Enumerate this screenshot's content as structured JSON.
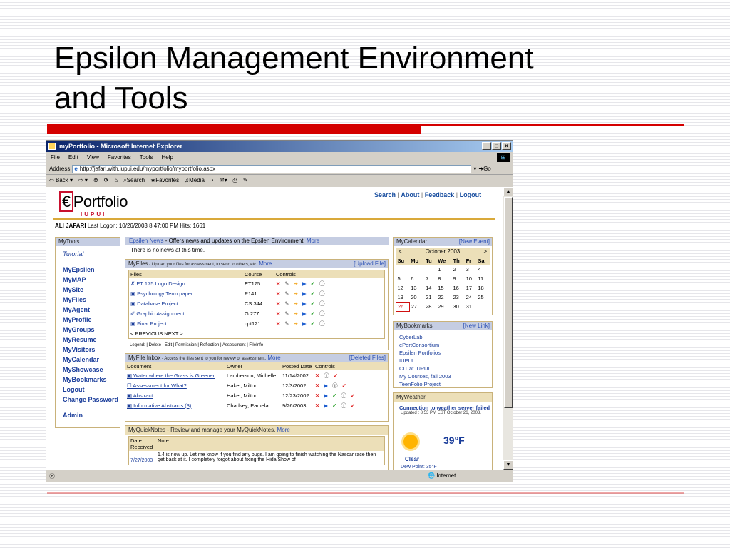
{
  "slide": {
    "title_line1": "Epsilon Management Environment",
    "title_line2": "and Tools"
  },
  "browser": {
    "title": "myPortfolio - Microsoft Internet Explorer",
    "menu": [
      "File",
      "Edit",
      "View",
      "Favorites",
      "Tools",
      "Help"
    ],
    "address_label": "Address",
    "url": "http://jafari.with.iupui.edu/myportfolio/myportfolio.aspx",
    "go_label": "Go",
    "toolbar": [
      "Back",
      "Search",
      "Favorites",
      "Media"
    ],
    "status_zone": "Internet"
  },
  "page": {
    "logo_text": "Portfolio",
    "logo_sub": "IUPUI",
    "nav": [
      "Search",
      "About",
      "Feedback",
      "Logout"
    ],
    "user": "ALI JAFARI",
    "last_logon": "Last Logon: 10/26/2003 8:47:00 PM Hits: 1661"
  },
  "mytools": {
    "title": "MyTools",
    "tutorial": "Tutorial",
    "items": [
      "MyEpsilen",
      "MyMAP",
      "MySite",
      "MyFiles",
      "MyAgent",
      "MyProfile",
      "MyGroups",
      "MyResume",
      "MyVisitors",
      "MyCalendar",
      "MyShowcase",
      "MyBookmarks",
      "Logout",
      "Change Password"
    ],
    "admin": "Admin"
  },
  "news": {
    "title": "Epsilen News",
    "desc": " - Offers news and updates on the Epsilen Environment.",
    "more": "More",
    "body": "There is no news at this time."
  },
  "myfiles": {
    "title": "MyFiles",
    "desc": " - Upload your files for assessment, to send to others, etc.",
    "more": "More",
    "upload": "[Upload File]",
    "columns": [
      "Files",
      "Course",
      "Controls"
    ],
    "rows": [
      {
        "file": "ET 175 Logo Design",
        "course": "ET175"
      },
      {
        "file": "Psychology Term paper",
        "course": "P141"
      },
      {
        "file": "Database Project",
        "course": "CS 344"
      },
      {
        "file": "Graphic Assignment",
        "course": "G 277"
      },
      {
        "file": "Final Project",
        "course": "cpt121"
      }
    ],
    "pager": "< PREVIOUS NEXT >",
    "legend": "Legend: | Delete | Edit | Permission | Reflection | Assessment | FileInfo"
  },
  "inbox": {
    "title": "MyFile Inbox",
    "desc": " - Access the files sent to you for review or assessment.",
    "more": "More",
    "deleted": "[Deleted Files]",
    "columns": [
      "Document",
      "Owner",
      "Posted Date",
      "Controls"
    ],
    "rows": [
      {
        "doc": "Water where the Grass is Greener",
        "owner": "Lamberson, Michelle",
        "date": "11/14/2002"
      },
      {
        "doc": "Assessment for What?",
        "owner": "Hakel, Milton",
        "date": "12/3/2002"
      },
      {
        "doc": "Abstract",
        "owner": "Hakel, Milton",
        "date": "12/23/2002"
      },
      {
        "doc": "Informative Abstracts (3)",
        "owner": "Chadsey, Pamela",
        "date": "9/26/2003"
      }
    ]
  },
  "quicknotes": {
    "title": "MyQuickNotes",
    "desc": " - Review and manage your MyQuickNotes.",
    "more": "More",
    "col_date": "Date Received",
    "col_note": "Note",
    "date": "7/27/2003",
    "note": "1.4 is now up. Let me know if you find any bugs. I am going to finish watching the Nascar race then get back at it. I completely forgot about fixing the Hide/Show of"
  },
  "calendar": {
    "title": "MyCalendar",
    "new_event": "[New Event]",
    "month": "October 2003",
    "days": [
      "Su",
      "Mo",
      "Tu",
      "We",
      "Th",
      "Fr",
      "Sa"
    ],
    "weeks": [
      [
        "",
        "",
        "",
        "1",
        "2",
        "3",
        "4"
      ],
      [
        "5",
        "6",
        "7",
        "8",
        "9",
        "10",
        "11"
      ],
      [
        "12",
        "13",
        "14",
        "15",
        "16",
        "17",
        "18"
      ],
      [
        "19",
        "20",
        "21",
        "22",
        "23",
        "24",
        "25"
      ],
      [
        "26",
        "27",
        "28",
        "29",
        "30",
        "31",
        ""
      ]
    ],
    "today": "26"
  },
  "bookmarks": {
    "title": "MyBookmarks",
    "new_link": "[New Link]",
    "items": [
      "CyberLab",
      "ePortConsortium",
      "Epsilen Portfolios",
      "IUPUI",
      "CIT at IUPUI",
      "My Courses, fall 2003",
      "TeenFolio Project"
    ]
  },
  "weather": {
    "title": "MyWeather",
    "status": "Connection to weather server failed",
    "updated": "Updated : 8:53 PM EST October 26, 2003.",
    "temp": "39°F",
    "condition": "Clear",
    "dew": "Dew Point: 35°F"
  }
}
